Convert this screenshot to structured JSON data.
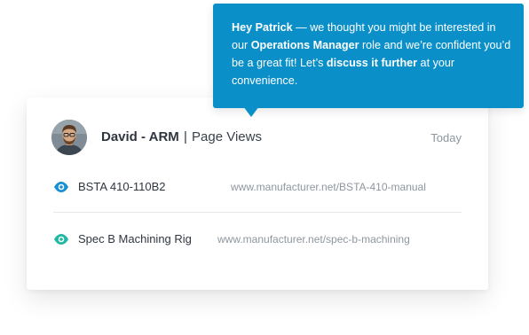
{
  "message": {
    "greeting": "Hey Patrick",
    "part1": " — we thought you might be interested in our ",
    "role": "Operations Manager",
    "part2": " role and we’re confident you’d be a great fit! Let’s ",
    "cta": "discuss it further",
    "part3": " at your convenience."
  },
  "activity": {
    "contact_name": "David - ARM",
    "separator": "|",
    "activity_type": "Page Views",
    "date": "Today",
    "items": [
      {
        "label": "BSTA 410-110B2",
        "url": "www.manufacturer.net/BSTA-410-manual",
        "icon": "eye-icon"
      },
      {
        "label": "Spec B Machining Rig",
        "url": "www.manufacturer.net/spec-b-machining",
        "icon": "eye-icon"
      }
    ]
  },
  "colors": {
    "bubble": "#0a8fc9",
    "eye_blue": "#1a8fd1",
    "eye_teal": "#1fb8a3"
  }
}
